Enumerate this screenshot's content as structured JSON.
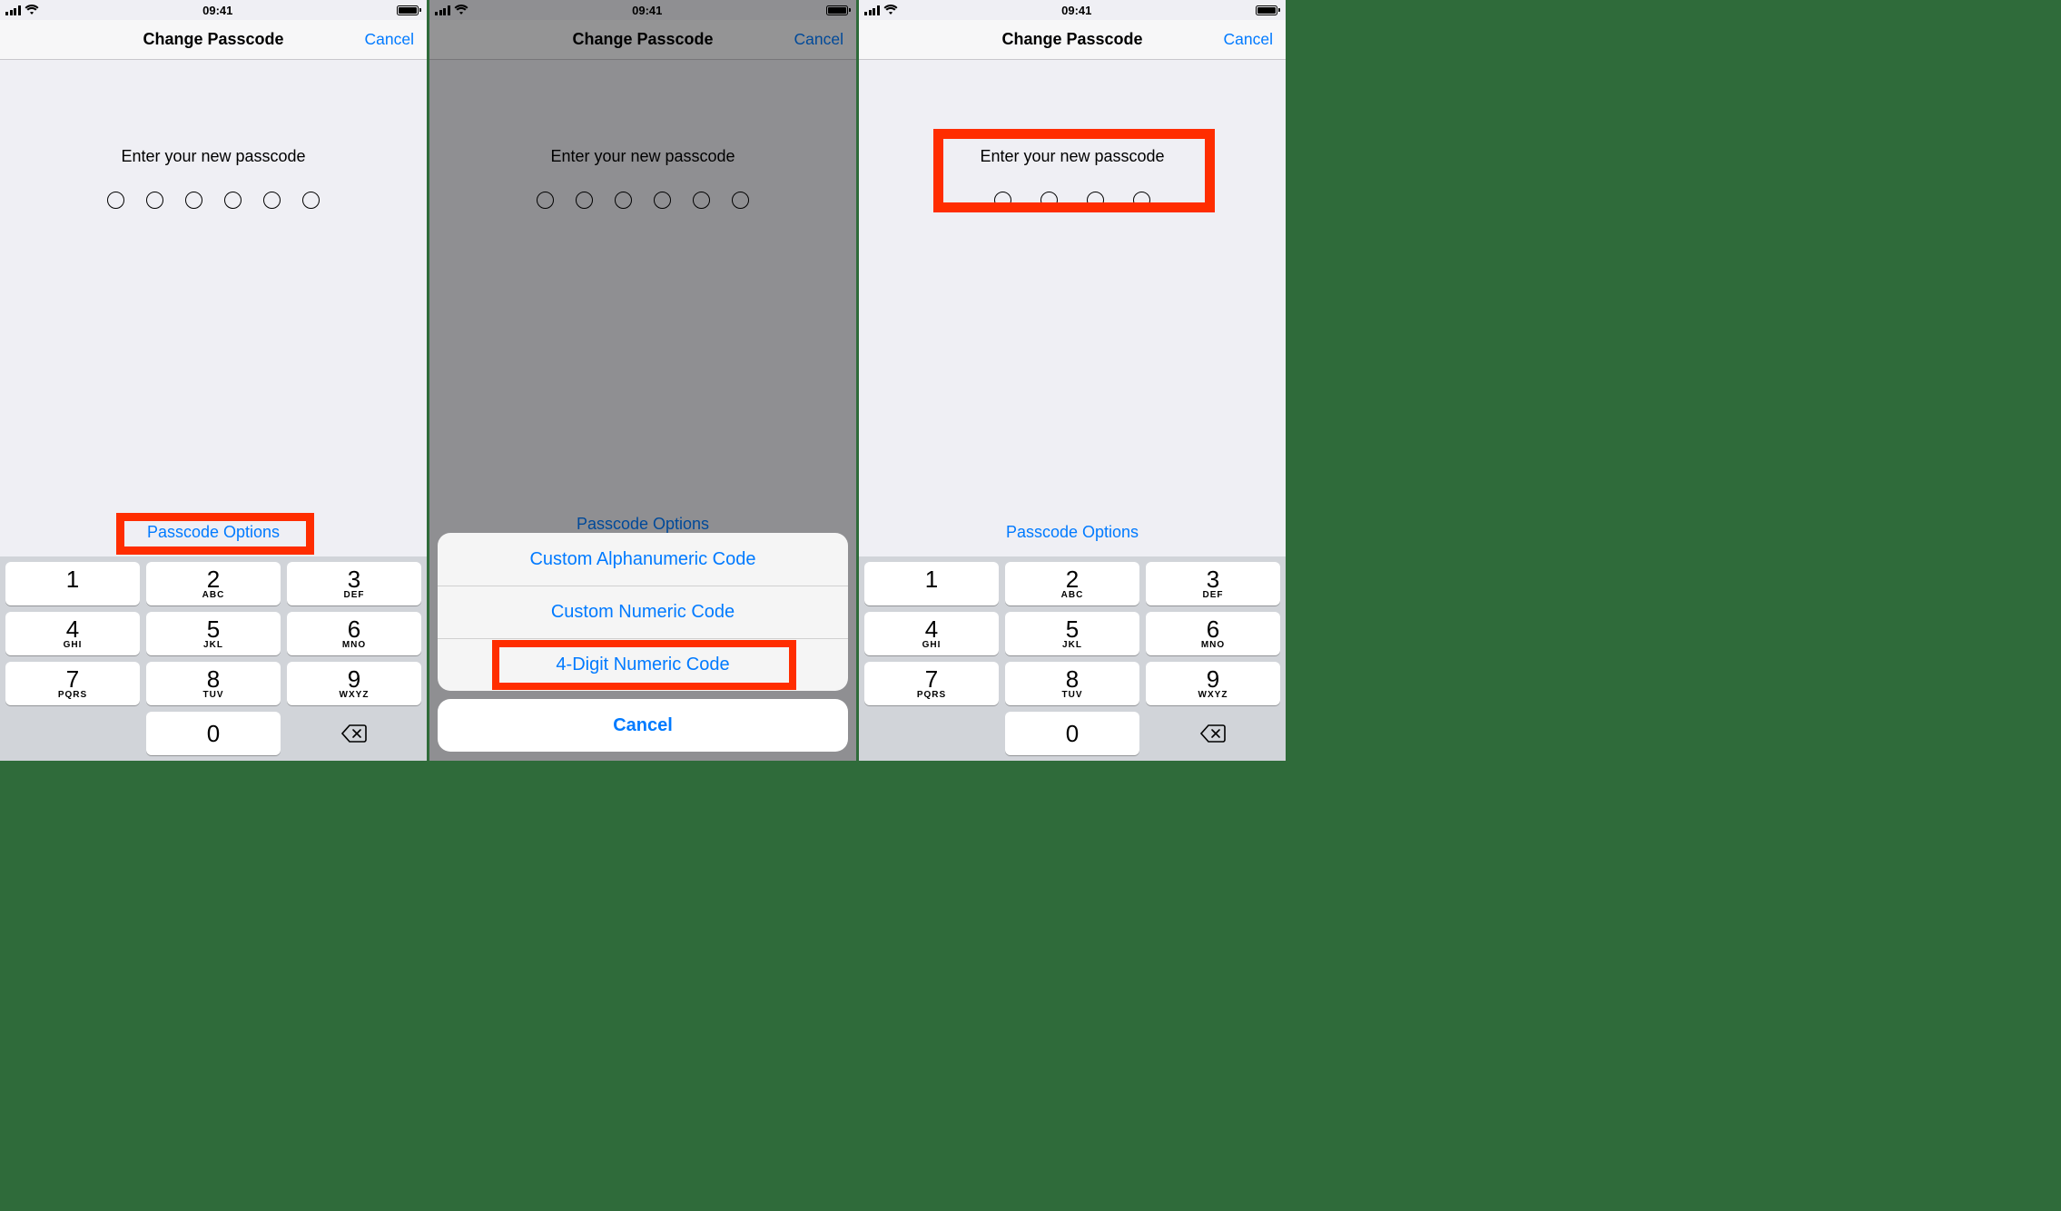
{
  "status": {
    "time": "09:41"
  },
  "nav": {
    "title": "Change Passcode",
    "cancel": "Cancel"
  },
  "prompt": "Enter your new passcode",
  "options_link": "Passcode Options",
  "keypad": [
    {
      "digit": "1",
      "letters": ""
    },
    {
      "digit": "2",
      "letters": "ABC"
    },
    {
      "digit": "3",
      "letters": "DEF"
    },
    {
      "digit": "4",
      "letters": "GHI"
    },
    {
      "digit": "5",
      "letters": "JKL"
    },
    {
      "digit": "6",
      "letters": "MNO"
    },
    {
      "digit": "7",
      "letters": "PQRS"
    },
    {
      "digit": "8",
      "letters": "TUV"
    },
    {
      "digit": "9",
      "letters": "WXYZ"
    },
    {
      "digit": "0",
      "letters": ""
    }
  ],
  "sheet": {
    "items": [
      "Custom Alphanumeric Code",
      "Custom Numeric Code",
      "4-Digit Numeric Code"
    ],
    "cancel": "Cancel"
  },
  "screens": {
    "left": {
      "dot_count": 6,
      "highlight": "options"
    },
    "middle": {
      "dot_count": 6,
      "action_sheet": true,
      "highlight_item_index": 2
    },
    "right": {
      "dot_count": 4,
      "highlight": "prompt"
    }
  }
}
